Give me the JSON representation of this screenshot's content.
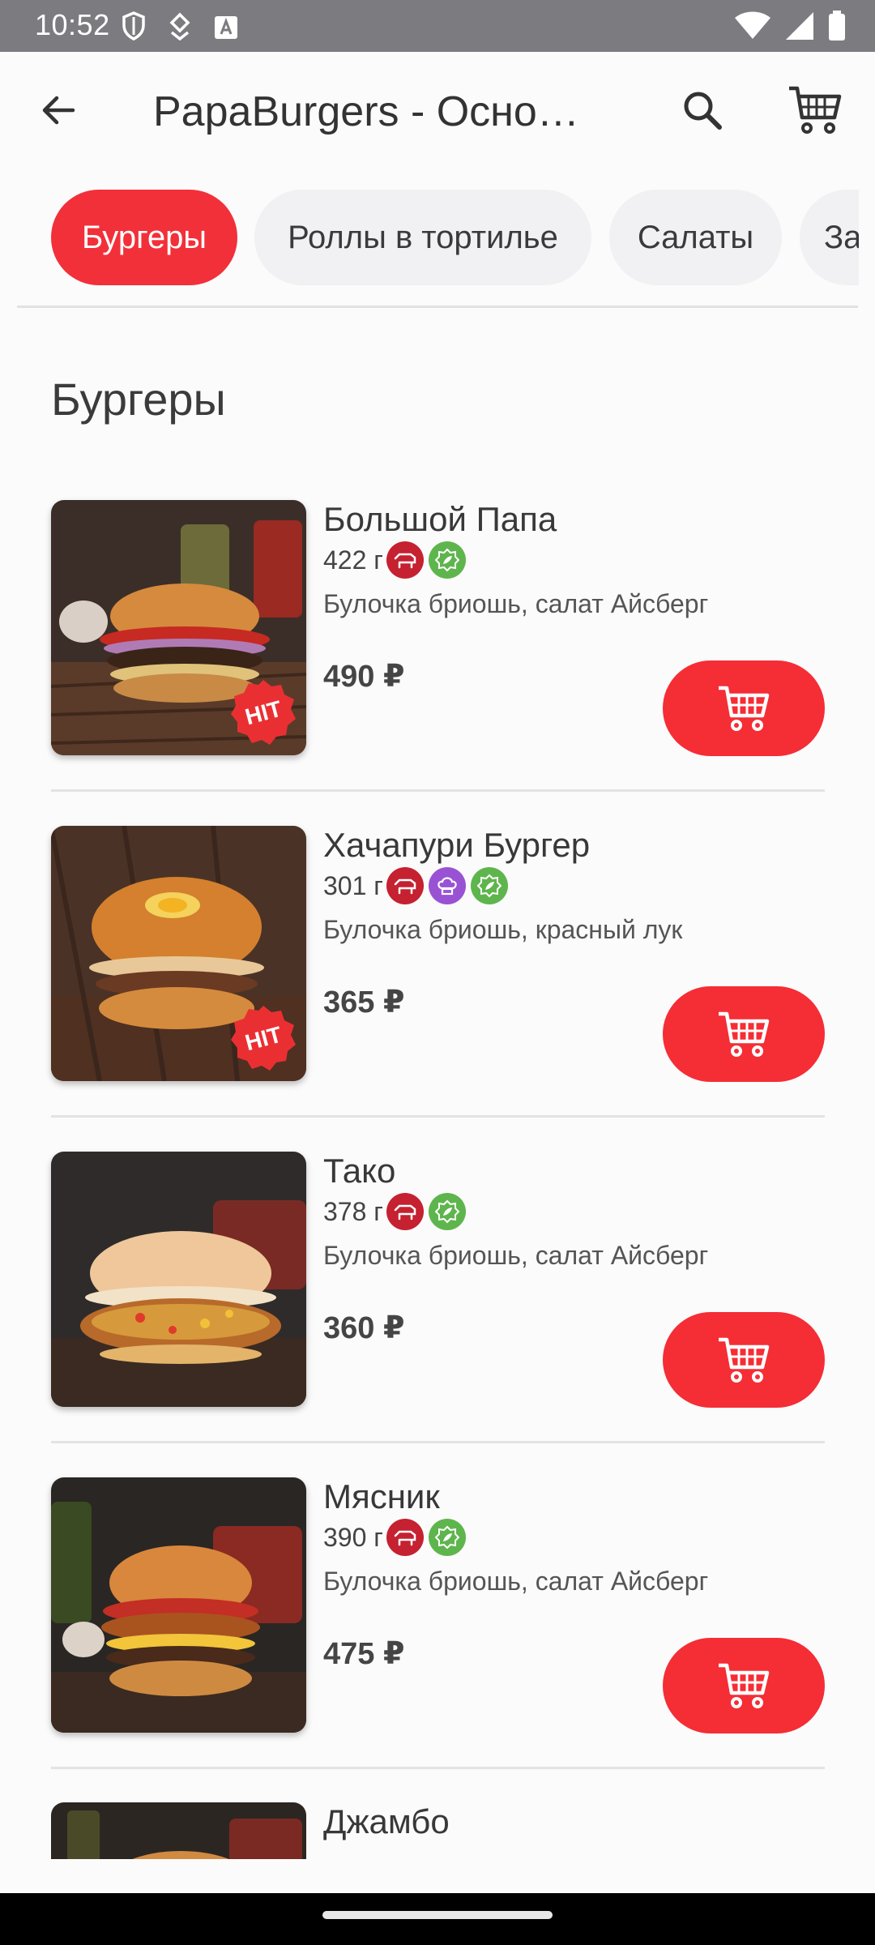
{
  "status_bar": {
    "time": "10:52"
  },
  "app_bar": {
    "title": "PapaBurgers - Основное меню",
    "icons": [
      "back-arrow-icon",
      "search-icon",
      "cart-icon"
    ]
  },
  "categories": [
    {
      "label": "Бургеры",
      "active": true
    },
    {
      "label": "Роллы в тортилье",
      "active": false
    },
    {
      "label": "Салаты",
      "active": false
    },
    {
      "label": "Закуски",
      "active": false
    }
  ],
  "section": {
    "title": "Бургеры"
  },
  "products": [
    {
      "name": "Большой Папа",
      "weight": "422 г",
      "description": "Булочка бриошь, салат Айсберг",
      "price": "490 ₽",
      "hit": true,
      "badge_text": "HIT",
      "tags": [
        "meat",
        "veg"
      ]
    },
    {
      "name": "Хачапури Бургер",
      "weight": "301 г",
      "description": "Булочка бриошь, красный лук",
      "price": "365 ₽",
      "hit": true,
      "badge_text": "HIT",
      "tags": [
        "meat",
        "cheese",
        "veg"
      ]
    },
    {
      "name": "Тако",
      "weight": "378 г",
      "description": "Булочка бриошь, салат Айсберг",
      "price": "360 ₽",
      "hit": false,
      "tags": [
        "meat",
        "veg"
      ]
    },
    {
      "name": "Мясник",
      "weight": "390 г",
      "description": "Булочка бриошь, салат Айсберг",
      "price": "475 ₽",
      "hit": false,
      "tags": [
        "meat",
        "veg"
      ]
    }
  ],
  "partial_product": {
    "name": "Джамбо"
  },
  "colors": {
    "accent": "#f52d35",
    "meat_tag": "#c52130",
    "veg_tag": "#5fb54d",
    "cheese_tag": "#9a52d4",
    "status_bar": "#7c7b80"
  }
}
